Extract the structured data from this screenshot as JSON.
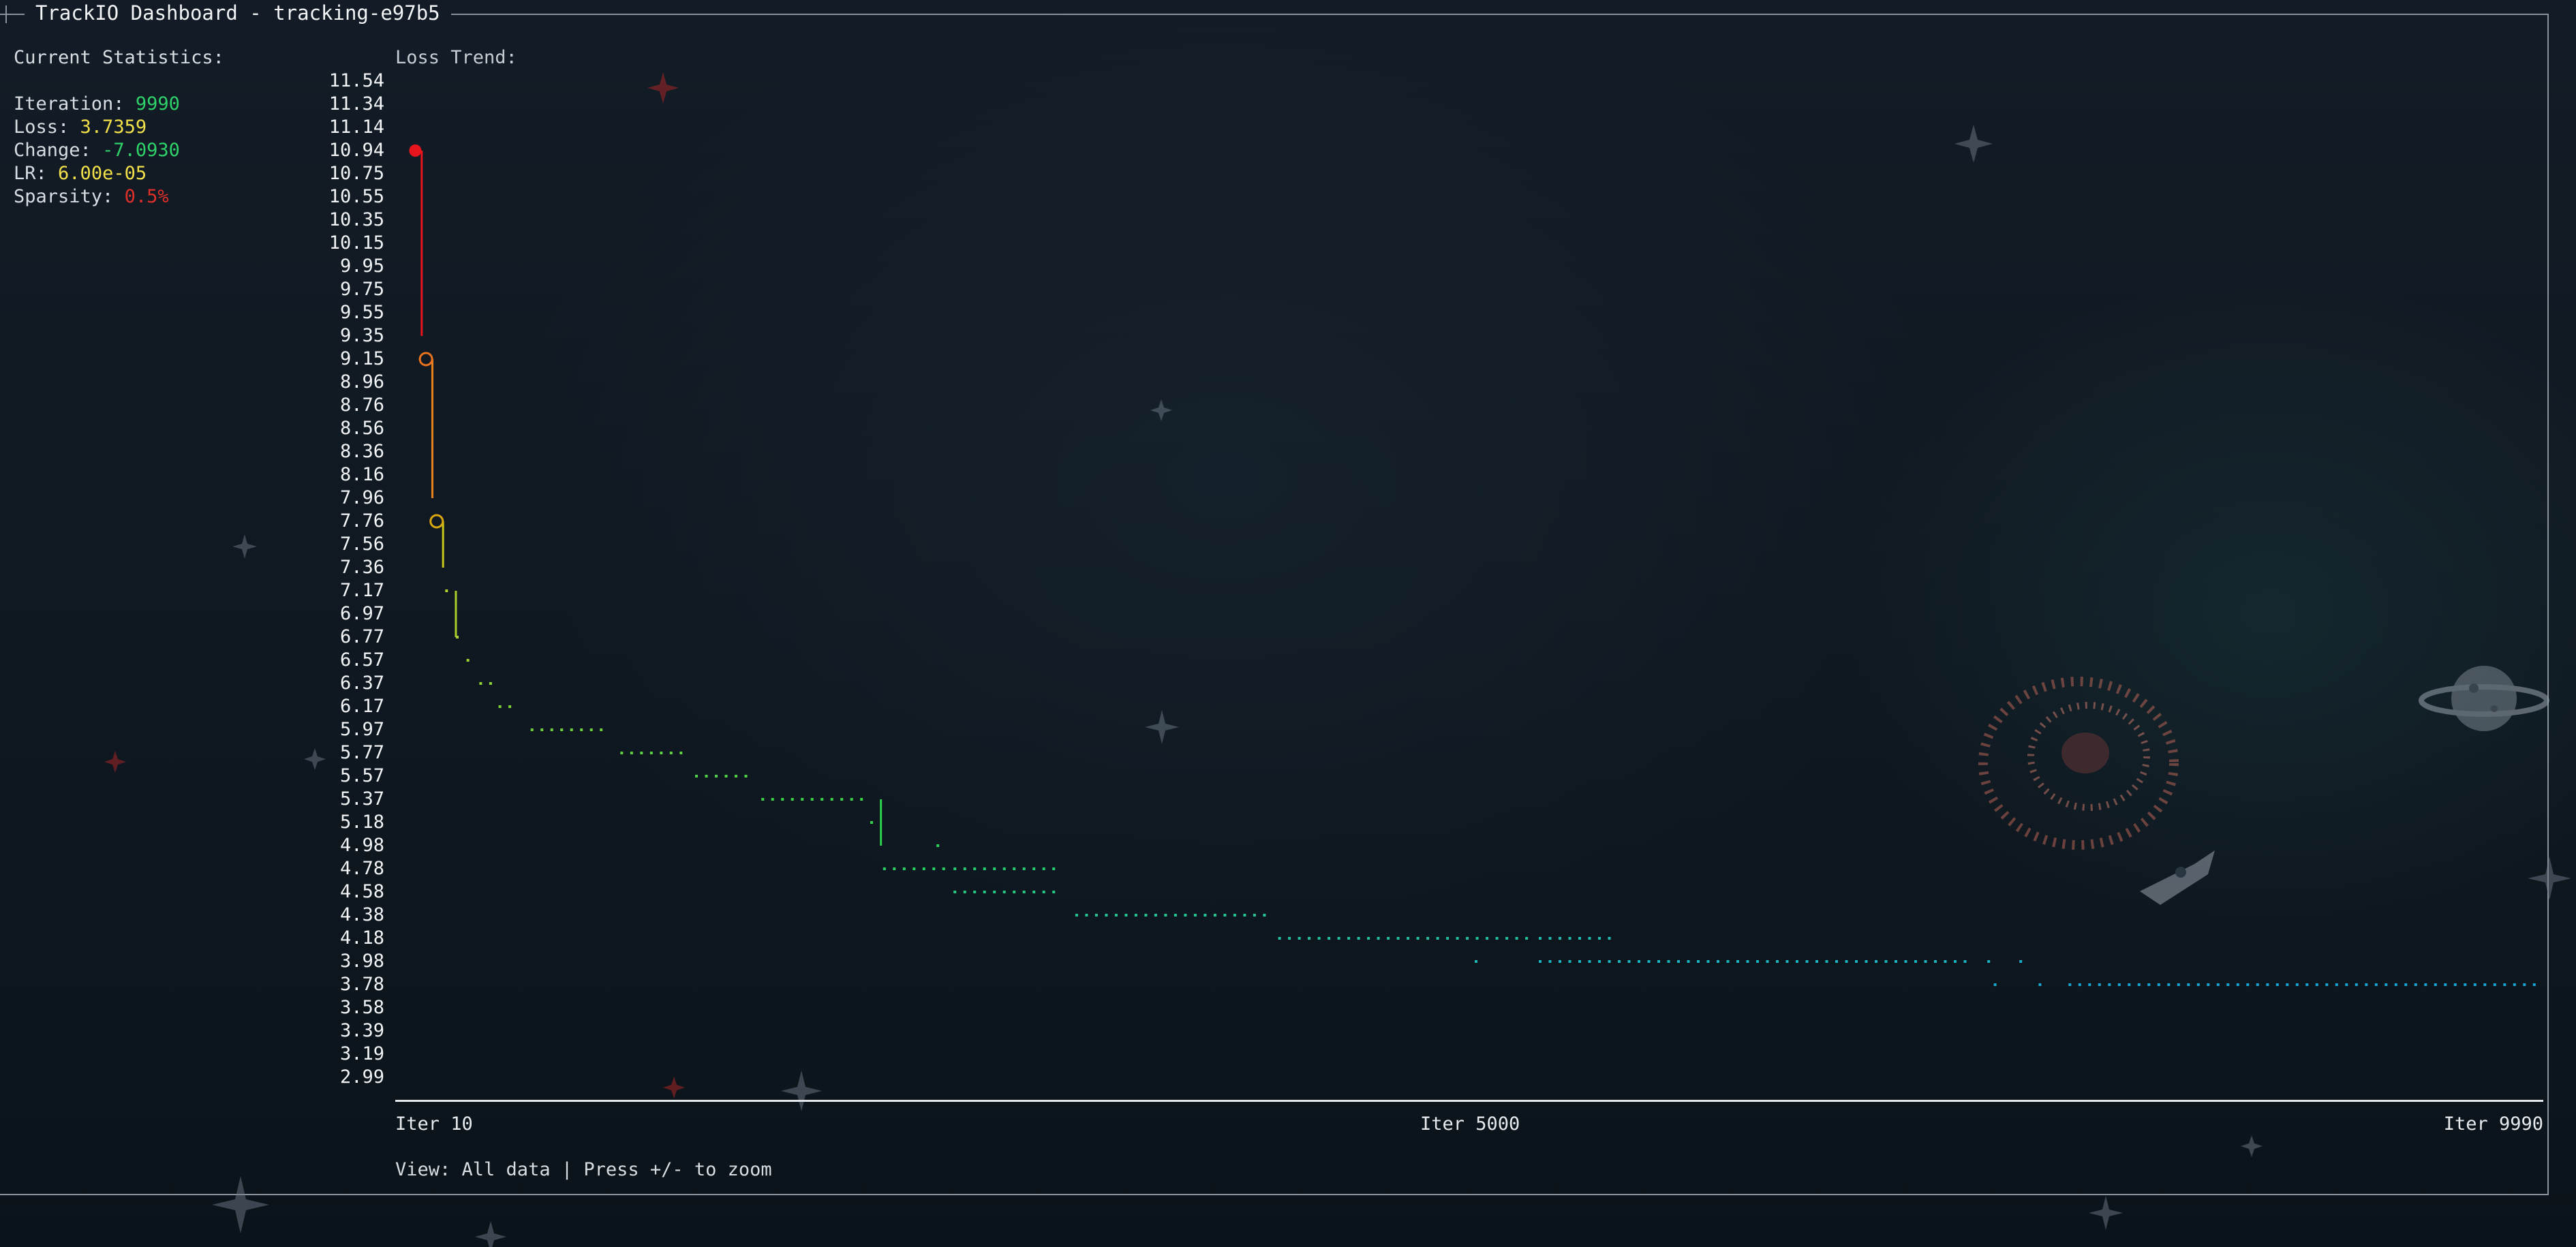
{
  "window": {
    "title": "TrackIO Dashboard - tracking-e97b5"
  },
  "stats": {
    "heading": "Current Statistics:",
    "iteration": {
      "label": "Iteration:",
      "value": "9990",
      "color": "#2fd26a"
    },
    "loss": {
      "label": "Loss:",
      "value": "3.7359",
      "color": "#f2e04a"
    },
    "change": {
      "label": "Change:",
      "value": "-7.0930",
      "color": "#2fd26a"
    },
    "lr": {
      "label": "LR:",
      "value": "6.00e-05",
      "color": "#f2e04a"
    },
    "sparsity": {
      "label": "Sparsity:",
      "value": "0.5%",
      "color": "#e0302a"
    }
  },
  "chart": {
    "title": "Loss Trend:",
    "x_labels": {
      "start": "Iter 10",
      "mid": "Iter 5000",
      "end": "Iter 9990"
    },
    "status": "View: All data | Press +/- to zoom"
  },
  "chart_data": {
    "type": "line",
    "title": "Loss Trend:",
    "xlabel": "",
    "ylabel": "",
    "xlim": [
      10,
      9990
    ],
    "ylim": [
      2.99,
      11.54
    ],
    "grid": false,
    "y_tick_labels": [
      "11.54",
      "11.34",
      "11.14",
      "10.94",
      "10.75",
      "10.55",
      "10.35",
      "10.15",
      "9.95",
      "9.75",
      "9.55",
      "9.35",
      "9.15",
      "8.96",
      "8.76",
      "8.56",
      "8.36",
      "8.16",
      "7.96",
      "7.76",
      "7.56",
      "7.36",
      "7.17",
      "6.97",
      "6.77",
      "6.57",
      "6.37",
      "6.17",
      "5.97",
      "5.77",
      "5.57",
      "5.37",
      "5.18",
      "4.98",
      "4.78",
      "4.58",
      "4.38",
      "4.18",
      "3.98",
      "3.78",
      "3.58",
      "3.39",
      "3.19",
      "2.99"
    ],
    "x_tick_labels": [
      "Iter 10",
      "Iter 5000",
      "Iter 9990"
    ],
    "markers": [
      {
        "x": 40,
        "y": 10.94,
        "style": "filled",
        "color": "#e8141e"
      },
      {
        "x": 90,
        "y": 9.15,
        "style": "hollow",
        "color": "#e8721e"
      },
      {
        "x": 140,
        "y": 7.76,
        "style": "hollow",
        "color": "#d8a80e"
      }
    ],
    "drops": [
      {
        "x": 70,
        "y_from": 10.94,
        "y_to": 9.35,
        "color": "#e8141e"
      },
      {
        "x": 120,
        "y_from": 9.15,
        "y_to": 7.96,
        "color": "#e8821e"
      },
      {
        "x": 170,
        "y_from": 7.76,
        "y_to": 7.36,
        "color": "#c8c818"
      },
      {
        "x": 230,
        "y_from": 7.17,
        "y_to": 6.77,
        "color": "#a8d02a"
      },
      {
        "x": 2220,
        "y_from": 5.37,
        "y_to": 4.98,
        "color": "#2ad24e"
      }
    ],
    "series": [
      {
        "segments": [
          {
            "x0": 180,
            "x1": 180,
            "y": 7.17,
            "color": "#b4d22e"
          },
          {
            "x0": 230,
            "x1": 230,
            "y": 6.77,
            "color": "#a8d230"
          },
          {
            "x0": 280,
            "x1": 280,
            "y": 6.57,
            "color": "#9cd232"
          },
          {
            "x0": 340,
            "x1": 390,
            "y": 6.37,
            "color": "#8cd234"
          },
          {
            "x0": 430,
            "x1": 520,
            "y": 6.17,
            "color": "#7cd238"
          },
          {
            "x0": 580,
            "x1": 940,
            "y": 5.97,
            "color": "#6cd23c"
          },
          {
            "x0": 1000,
            "x1": 1310,
            "y": 5.77,
            "color": "#5cd240"
          },
          {
            "x0": 1350,
            "x1": 1620,
            "y": 5.57,
            "color": "#4cd244"
          },
          {
            "x0": 1660,
            "x1": 2130,
            "y": 5.37,
            "color": "#3cd248"
          },
          {
            "x0": 2170,
            "x1": 2170,
            "y": 5.18,
            "color": "#34d24c"
          },
          {
            "x0": 2480,
            "x1": 2480,
            "y": 4.98,
            "color": "#2ed258"
          },
          {
            "x0": 2230,
            "x1": 2510,
            "y": 4.78,
            "color": "#28d064"
          },
          {
            "x0": 2560,
            "x1": 3050,
            "y": 4.78,
            "color": "#26cc70"
          },
          {
            "x0": 2560,
            "x1": 3050,
            "y": 4.58,
            "color": "#24c880"
          },
          {
            "x0": 3130,
            "x1": 4050,
            "y": 4.38,
            "color": "#22c490"
          },
          {
            "x0": 4080,
            "x1": 5250,
            "y": 4.18,
            "color": "#20c0a0"
          },
          {
            "x0": 5300,
            "x1": 5650,
            "y": 4.18,
            "color": "#1ebcb0"
          },
          {
            "x0": 5000,
            "x1": 5000,
            "y": 3.98,
            "color": "#1cb8b8"
          },
          {
            "x0": 5300,
            "x1": 7300,
            "y": 3.98,
            "color": "#1ab4c0"
          },
          {
            "x0": 7400,
            "x1": 7400,
            "y": 3.98,
            "color": "#1ab0c4"
          },
          {
            "x0": 7550,
            "x1": 7550,
            "y": 3.98,
            "color": "#1aacc8"
          },
          {
            "x0": 7430,
            "x1": 7470,
            "y": 3.78,
            "color": "#18a8cc"
          },
          {
            "x0": 7640,
            "x1": 7680,
            "y": 3.78,
            "color": "#18a6ce"
          },
          {
            "x0": 7780,
            "x1": 9990,
            "y": 3.78,
            "color": "#16a2d2"
          }
        ]
      }
    ]
  }
}
